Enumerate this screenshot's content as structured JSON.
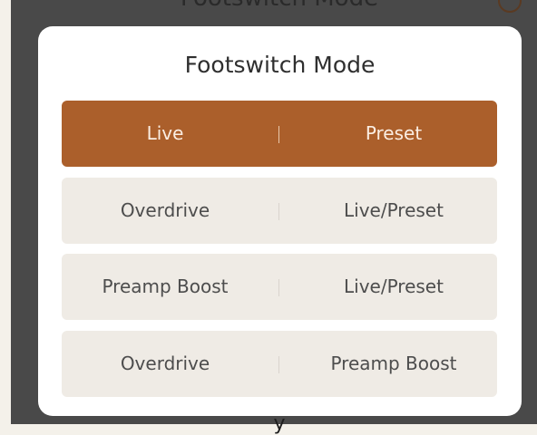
{
  "background": {
    "title": "Footswitch Mode",
    "fragment": "y"
  },
  "modal": {
    "title": "Footswitch Mode",
    "options": [
      {
        "left": "Live",
        "right": "Preset",
        "selected": true
      },
      {
        "left": "Overdrive",
        "right": "Live/Preset",
        "selected": false
      },
      {
        "left": "Preamp Boost",
        "right": "Live/Preset",
        "selected": false
      },
      {
        "left": "Overdrive",
        "right": "Preamp Boost",
        "selected": false
      }
    ]
  },
  "colors": {
    "accent": "#ab5f2b",
    "option_bg": "#efebe5",
    "overlay": "#494949"
  }
}
